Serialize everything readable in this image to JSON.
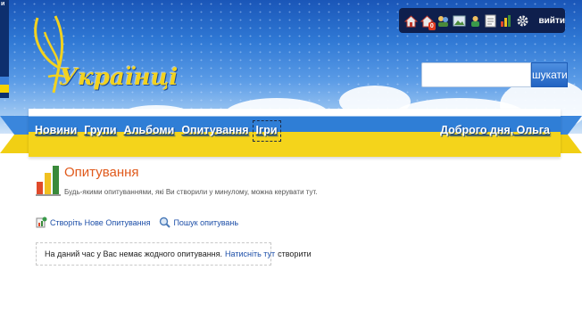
{
  "header": {
    "left_strip_text": "и",
    "logo_text": "Українці"
  },
  "toolbar": {
    "icons": [
      "home-icon",
      "friends-icon",
      "users-icon",
      "photo-icon",
      "notifications-icon",
      "notes-icon",
      "stats-icon",
      "gear-icon"
    ],
    "friends_badge": "0",
    "logout_label": "вийти"
  },
  "search": {
    "value": "",
    "placeholder": "",
    "button_label": "шукати"
  },
  "nav": {
    "items": [
      {
        "label": "Новини"
      },
      {
        "label": "Групи"
      },
      {
        "label": "Альбоми"
      },
      {
        "label": "Опитування"
      },
      {
        "label": "Ігри"
      }
    ],
    "active_index": 4,
    "greeting": "Доброго дня,  Ольга"
  },
  "page": {
    "title": "Опитування",
    "description": "Будь-якими опитуваннями, які Ви створили у минулому, можна керувати тут.",
    "actions": {
      "create_label": "Створіть Нове Опитування",
      "search_label": "Пошук опитувань"
    },
    "notice": {
      "text_before": "На даний час у Вас немає жодного опитування.",
      "link": "Натисніть тут",
      "text_after": "створити"
    }
  },
  "colors": {
    "sky_top": "#1a56b8",
    "ribbon_blue": "#2f7ed6",
    "ribbon_yellow": "#f4d41b",
    "title_orange": "#e05a1c",
    "link_blue": "#1d4fa8"
  }
}
